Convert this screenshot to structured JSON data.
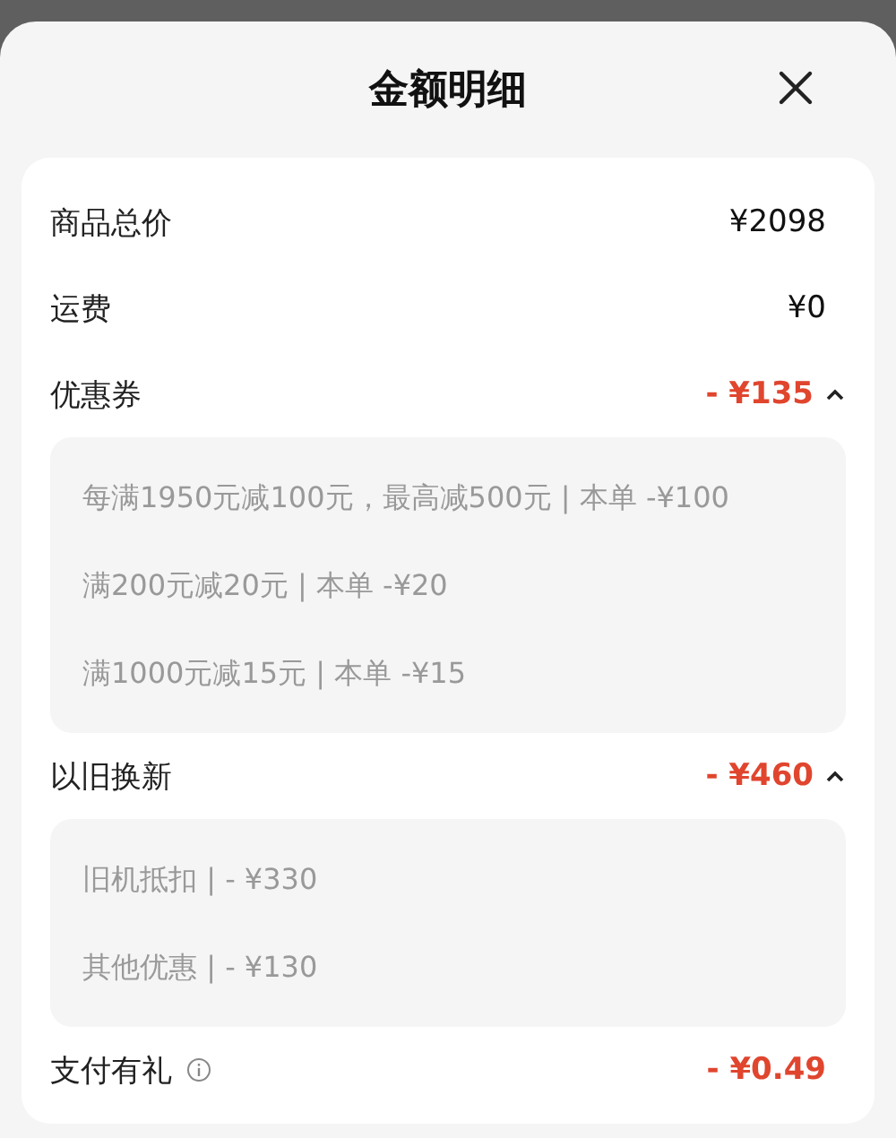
{
  "sheet": {
    "title": "金额明细"
  },
  "rows": [
    {
      "label": "商品总价",
      "amount": "¥2098",
      "kind": "normal"
    },
    {
      "label": "运费",
      "amount": "¥0",
      "kind": "normal"
    },
    {
      "label": "优惠券",
      "amount": "- ¥135",
      "kind": "discount",
      "expanded": true,
      "details": [
        "每满1950元减100元，最高减500元 | 本单 -¥100",
        "满200元减20元 | 本单 -¥20",
        "满1000元减15元 | 本单 -¥15"
      ]
    },
    {
      "label": "以旧换新",
      "amount": "- ¥460",
      "kind": "discount",
      "expanded": true,
      "details": [
        "旧机抵扣 | - ¥330",
        "其他优惠 | - ¥130"
      ]
    },
    {
      "label": "支付有礼",
      "amount": "- ¥0.49",
      "kind": "discount",
      "info": true
    }
  ]
}
